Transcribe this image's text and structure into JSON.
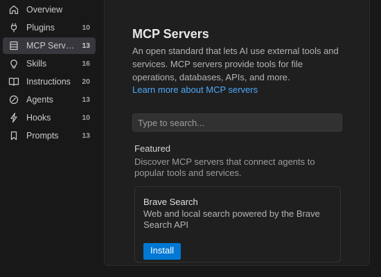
{
  "sidebar": {
    "items": [
      {
        "label": "Overview",
        "count": "",
        "icon": "home-icon"
      },
      {
        "label": "Plugins",
        "count": "10",
        "icon": "plug-icon"
      },
      {
        "label": "MCP Servers",
        "count": "13",
        "icon": "server-icon",
        "active": true
      },
      {
        "label": "Skills",
        "count": "16",
        "icon": "lightbulb-icon"
      },
      {
        "label": "Instructions",
        "count": "20",
        "icon": "book-icon"
      },
      {
        "label": "Agents",
        "count": "13",
        "icon": "agent-icon"
      },
      {
        "label": "Hooks",
        "count": "10",
        "icon": "lightning-icon"
      },
      {
        "label": "Prompts",
        "count": "13",
        "icon": "bookmark-icon"
      }
    ]
  },
  "main": {
    "title": "MCP Servers",
    "description": "An open standard that lets AI use external tools and services. MCP servers provide tools for file operations, databases, APIs, and more.",
    "learn_more": "Learn more about MCP servers",
    "search_placeholder": "Type to search...",
    "featured": {
      "title": "Featured",
      "description": "Discover MCP servers that connect agents to popular tools and services.",
      "cards": [
        {
          "title": "Brave Search",
          "description": "Web and local search powered by the Brave Search API",
          "button": "Install"
        }
      ]
    }
  },
  "colors": {
    "accent": "#0078d4",
    "link": "#4daafc",
    "background": "#181818"
  }
}
